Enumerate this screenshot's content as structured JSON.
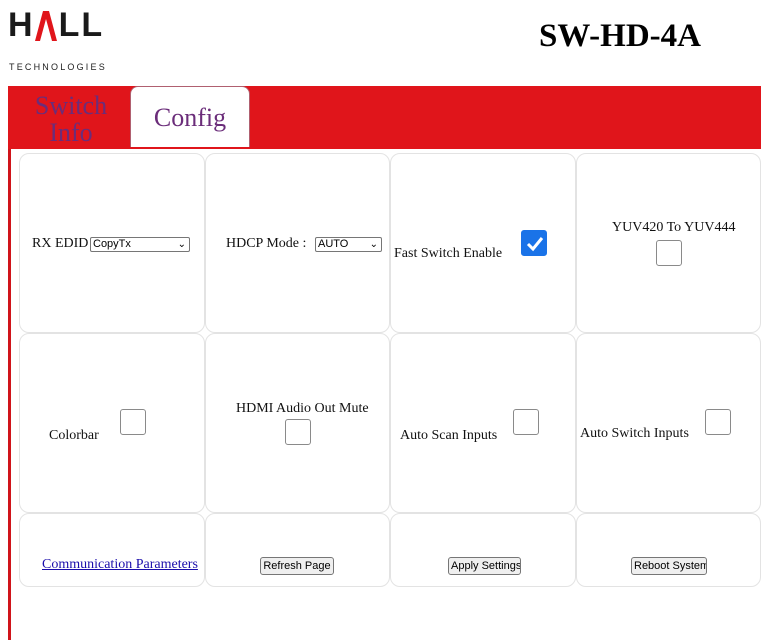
{
  "logo": {
    "letters": [
      "H",
      "A",
      "L",
      "L"
    ],
    "subtitle": "TECHNOLOGIES",
    "accent_color": "#e0151b"
  },
  "header": {
    "model": "SW-HD-4A"
  },
  "tabs": [
    {
      "label_line1": "Switch",
      "label_line2": "Info",
      "active": false
    },
    {
      "label": "Config",
      "active": true
    }
  ],
  "colors": {
    "tab_bar": "#e0151b",
    "tab_text": "#6b2d7a",
    "checkbox_checked": "#1a73e8"
  },
  "settings": {
    "rx_edid": {
      "label": "RX EDID",
      "value": "CopyTx"
    },
    "hdcp_mode": {
      "label": "HDCP Mode :",
      "value": "AUTO"
    },
    "fast_switch": {
      "label": "Fast Switch Enable",
      "checked": true
    },
    "yuv420": {
      "label": "YUV420 To YUV444",
      "checked": false
    },
    "colorbar": {
      "label": "Colorbar",
      "checked": false
    },
    "hdmi_audio_mute": {
      "label": "HDMI Audio Out Mute",
      "checked": false
    },
    "auto_scan": {
      "label": "Auto Scan Inputs",
      "checked": false
    },
    "auto_switch": {
      "label": "Auto Switch Inputs",
      "checked": false
    }
  },
  "actions": {
    "comm_params": "Communication Parameters",
    "refresh": "Refresh Page",
    "apply": "Apply Settings",
    "reboot": "Reboot System"
  }
}
